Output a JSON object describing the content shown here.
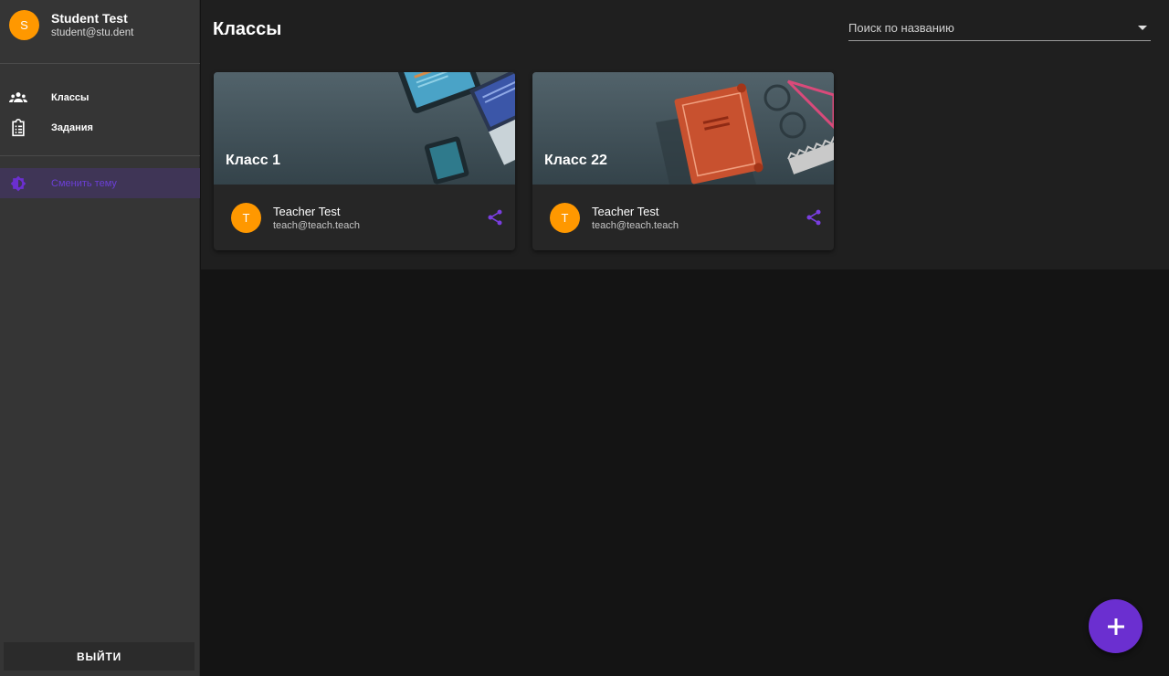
{
  "profile": {
    "initial": "S",
    "name": "Student Test",
    "email": "student@stu.dent"
  },
  "nav": {
    "classes": {
      "label": "Классы",
      "icon": "people-icon"
    },
    "tasks": {
      "label": "Задания",
      "icon": "clipboard-list-icon"
    },
    "theme": {
      "label": "Сменить тему",
      "icon": "theme-icon"
    }
  },
  "logout_label": "ВЫЙТИ",
  "header": {
    "title": "Классы",
    "search_placeholder": "Поиск по названию"
  },
  "cards": [
    {
      "title": "Класс 1",
      "teacher_initial": "T",
      "teacher_name": "Teacher Test",
      "teacher_email": "teach@teach.teach"
    },
    {
      "title": "Класс 22",
      "teacher_initial": "T",
      "teacher_name": "Teacher Test",
      "teacher_email": "teach@teach.teach"
    }
  ],
  "colors": {
    "accent": "#6b2fd0",
    "avatar": "#ff9800",
    "sidebar": "#353535",
    "background": "#141414"
  }
}
